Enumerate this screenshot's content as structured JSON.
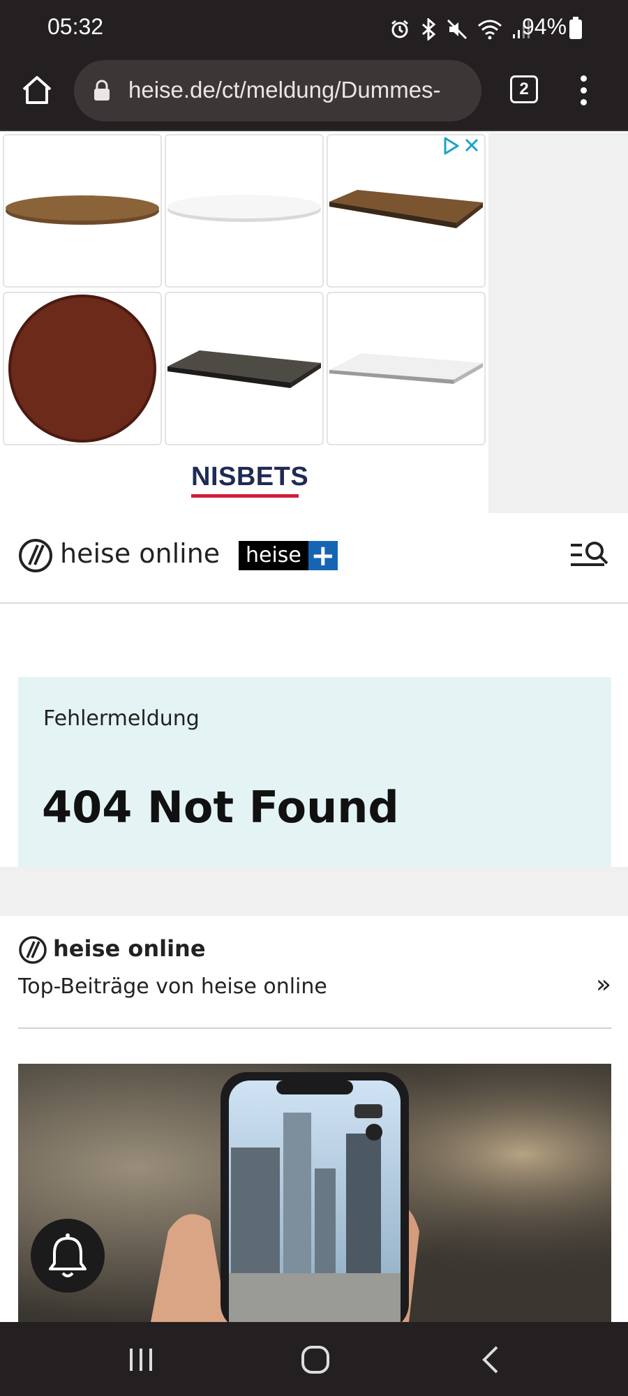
{
  "status_bar": {
    "time": "05:32",
    "battery": "94%",
    "icons": [
      "alarm-icon",
      "bluetooth-icon",
      "mute-icon",
      "wifi-icon",
      "signal-icon",
      "battery-icon"
    ]
  },
  "browser": {
    "url": "heise.de/ct/meldung/Dummes-",
    "tab_count": "2"
  },
  "ad": {
    "brand": "NISBETS",
    "brand_color": "#1f2a55",
    "accent_color": "#d11d3b"
  },
  "header": {
    "logo_text": "heise online",
    "plus_word": "heise",
    "plus_symbol": "+"
  },
  "error": {
    "kicker": "Fehlermeldung",
    "headline": "404 Not Found",
    "background": "#e4f3f4"
  },
  "teaser": {
    "logo_text": "heise online",
    "subtitle": "Top-Beiträge von heise online",
    "more": "»"
  },
  "colors": {
    "chrome": "#241f20",
    "plus_blue": "#1665b4"
  }
}
